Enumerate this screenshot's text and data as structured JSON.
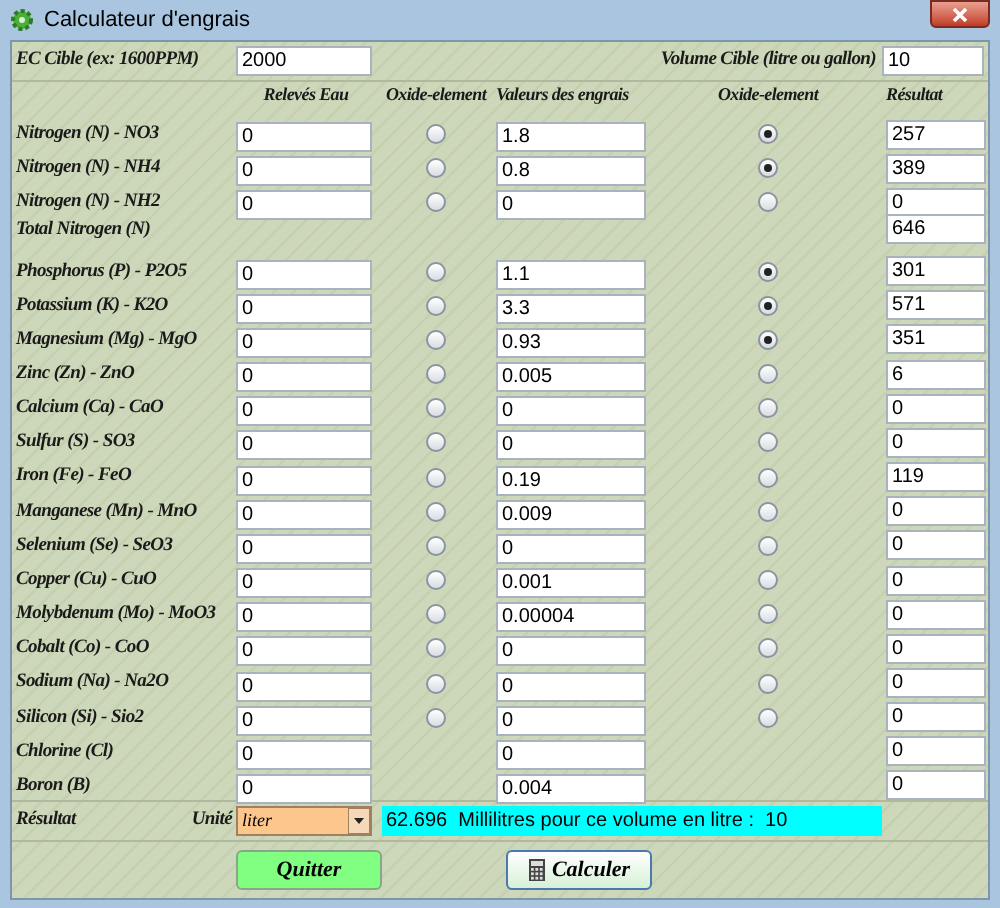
{
  "window": {
    "title": "Calculateur d'engrais"
  },
  "ec_target": {
    "label": "EC Cible (ex: 1600PPM)",
    "value": "2000"
  },
  "volume_target": {
    "label": "Volume Cible (litre ou gallon)",
    "value": "10"
  },
  "headers": [
    "Relevés Eau",
    "Oxide-element",
    "Valeurs des engrais",
    "Oxide-element",
    "Résultat"
  ],
  "rows": [
    {
      "label": "Nitrogen (N) - NO3",
      "water": "0",
      "water_oxide": false,
      "fertilizer": "1.8",
      "fertilizer_oxide": true,
      "result": "257"
    },
    {
      "label": "Nitrogen (N) - NH4",
      "water": "0",
      "water_oxide": false,
      "fertilizer": "0.8",
      "fertilizer_oxide": true,
      "result": "389"
    },
    {
      "label": "Nitrogen (N) - NH2",
      "water": "0",
      "water_oxide": false,
      "fertilizer": "0",
      "fertilizer_oxide": false,
      "result": "0"
    },
    {
      "label": "Total Nitrogen (N)",
      "result": "646"
    },
    {
      "label": "Phosphorus (P) - P2O5",
      "water": "0",
      "water_oxide": false,
      "fertilizer": "1.1",
      "fertilizer_oxide": true,
      "result": "301"
    },
    {
      "label": "Potassium (K) - K2O",
      "water": "0",
      "water_oxide": false,
      "fertilizer": "3.3",
      "fertilizer_oxide": true,
      "result": "571"
    },
    {
      "label": "Magnesium (Mg) - MgO",
      "water": "0",
      "water_oxide": false,
      "fertilizer": "0.93",
      "fertilizer_oxide": true,
      "result": "351"
    },
    {
      "label": "Zinc (Zn) - ZnO",
      "water": "0",
      "water_oxide": false,
      "fertilizer": "0.005",
      "fertilizer_oxide": false,
      "result": "6"
    },
    {
      "label": "Calcium (Ca) - CaO",
      "water": "0",
      "water_oxide": false,
      "fertilizer": "0",
      "fertilizer_oxide": false,
      "result": "0"
    },
    {
      "label": "Sulfur (S) - SO3",
      "water": "0",
      "water_oxide": false,
      "fertilizer": "0",
      "fertilizer_oxide": false,
      "result": "0"
    },
    {
      "label": "Iron (Fe) - FeO",
      "water": "0",
      "water_oxide": false,
      "fertilizer": "0.19",
      "fertilizer_oxide": false,
      "result": "119"
    },
    {
      "label": "Manganese (Mn) - MnO",
      "water": "0",
      "water_oxide": false,
      "fertilizer": "0.009",
      "fertilizer_oxide": false,
      "result": "0"
    },
    {
      "label": "Selenium (Se) - SeO3",
      "water": "0",
      "water_oxide": false,
      "fertilizer": "0",
      "fertilizer_oxide": false,
      "result": "0"
    },
    {
      "label": "Copper (Cu) - CuO",
      "water": "0",
      "water_oxide": false,
      "fertilizer": "0.001",
      "fertilizer_oxide": false,
      "result": "0"
    },
    {
      "label": "Molybdenum (Mo) - MoO3",
      "water": "0",
      "water_oxide": false,
      "fertilizer": "0.00004",
      "fertilizer_oxide": false,
      "result": "0"
    },
    {
      "label": "Cobalt (Co) - CoO",
      "water": "0",
      "water_oxide": false,
      "fertilizer": "0",
      "fertilizer_oxide": false,
      "result": "0"
    },
    {
      "label": "Sodium (Na) - Na2O",
      "water": "0",
      "water_oxide": false,
      "fertilizer": "0",
      "fertilizer_oxide": false,
      "result": "0"
    },
    {
      "label": "Silicon (Si) - Sio2",
      "water": "0",
      "water_oxide": false,
      "fertilizer": "0",
      "fertilizer_oxide": false,
      "result": "0"
    },
    {
      "label": "Chlorine (Cl)",
      "water": "0",
      "fertilizer": "0",
      "result": "0"
    },
    {
      "label": "Boron (B)",
      "water": "0",
      "fertilizer": "0.004",
      "result": "0"
    }
  ],
  "footer": {
    "label": "Résultat",
    "unit_label": "Unité",
    "unit_value": "liter",
    "output": "62.696  Millilitres pour ce volume en litre :  10"
  },
  "buttons": [
    {
      "kind": "quit",
      "label": "Quitter"
    },
    {
      "kind": "calculate",
      "label": "Calculer"
    }
  ]
}
